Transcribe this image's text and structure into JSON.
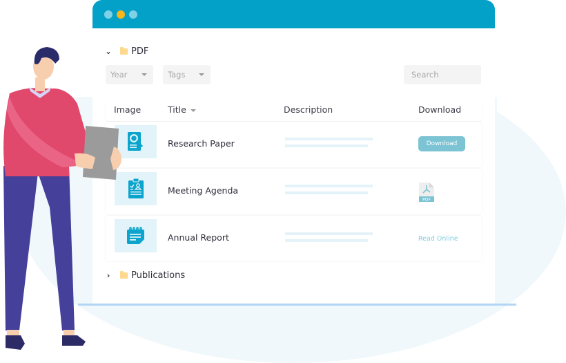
{
  "window": {
    "title_dots": [
      "close",
      "minimize",
      "maximize"
    ]
  },
  "folders": [
    {
      "label": "PDF",
      "expanded": true,
      "chevron": "chevron-down-icon"
    },
    {
      "label": "Publications",
      "expanded": false,
      "chevron": "chevron-right-icon"
    }
  ],
  "filters": {
    "year_label": "Year",
    "tags_label": "Tags",
    "search_placeholder": "Search"
  },
  "table": {
    "columns": [
      "Image",
      "Title",
      "Description",
      "Download"
    ],
    "rows": [
      {
        "icon": "research-search-icon",
        "title": "Research Paper",
        "download_type": "button",
        "download_label": "Download"
      },
      {
        "icon": "clipboard-agenda-icon",
        "title": "Meeting Agenda",
        "download_type": "pdf-icon",
        "download_label": "PDF"
      },
      {
        "icon": "notepad-report-icon",
        "title": "Annual Report",
        "download_type": "link",
        "download_label": "Read Online"
      }
    ]
  },
  "colors": {
    "accent": "#03a0c8",
    "button": "#7cc3d4",
    "thumb_bg": "#e2f3f9",
    "folder": "#fcd98f",
    "dot_yellow": "#f9b51a"
  }
}
